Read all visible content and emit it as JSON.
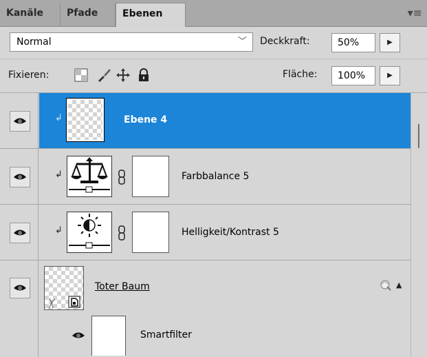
{
  "tabs": [
    {
      "label": "Kanäle",
      "active": false
    },
    {
      "label": "Pfade",
      "active": false
    },
    {
      "label": "Ebenen",
      "active": true
    }
  ],
  "blend_mode": {
    "value": "Normal"
  },
  "opacity": {
    "label": "Deckkraft:",
    "value": "50%"
  },
  "lock": {
    "label": "Fixieren:"
  },
  "fill": {
    "label": "Fläche:",
    "value": "100%"
  },
  "layers": [
    {
      "name": "Ebene 4",
      "selected": true
    },
    {
      "name": "Farbbalance 5",
      "selected": false
    },
    {
      "name": "Helligkeit/Kontrast 5",
      "selected": false
    },
    {
      "name": "Toter Baum",
      "selected": false
    },
    {
      "name": "Smartfilter",
      "selected": false
    }
  ],
  "colors": {
    "selection": "#1c85d8",
    "panel": "#d6d6d6",
    "tabbar": "#a9a9a9"
  },
  "icons": [
    "panel-menu-icon",
    "eye-icon",
    "clip-arrow-icon",
    "link-chain-icon",
    "smart-object-icon",
    "smartfilter-badge-icon"
  ]
}
